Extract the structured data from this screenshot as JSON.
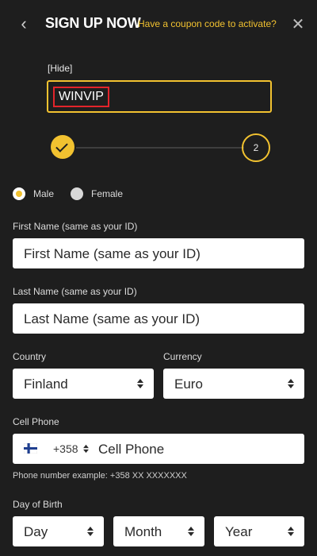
{
  "header": {
    "back_icon": "‹",
    "title": "SIGN UP NOW",
    "coupon_link": "Have a coupon code to activate?",
    "close_icon": "✕"
  },
  "coupon": {
    "hide_label": "[Hide]",
    "value": "WINVIP"
  },
  "stepper": {
    "current_step": 2,
    "step_2_label": "2"
  },
  "gender": {
    "options": [
      {
        "label": "Male",
        "selected": true
      },
      {
        "label": "Female",
        "selected": false
      }
    ]
  },
  "form": {
    "first_name": {
      "label": "First Name (same as your ID)",
      "placeholder": "First Name  (same as your ID)"
    },
    "last_name": {
      "label": "Last Name (same as your ID)",
      "placeholder": "Last Name (same as your ID)"
    },
    "country": {
      "label": "Country",
      "value": "Finland"
    },
    "currency": {
      "label": "Currency",
      "value": "Euro"
    },
    "cell_phone": {
      "label": "Cell Phone",
      "flag": "finland-flag",
      "dial_code": "+358",
      "placeholder": "Cell Phone",
      "example": "Phone number example: +358 XX XXXXXXX"
    },
    "day_of_birth": {
      "label": "Day of Birth",
      "day": "Day",
      "month": "Month",
      "year": "Year"
    }
  },
  "colors": {
    "background": "#1e1e1e",
    "accent": "#f2c230",
    "highlight_box": "#e3242b"
  }
}
